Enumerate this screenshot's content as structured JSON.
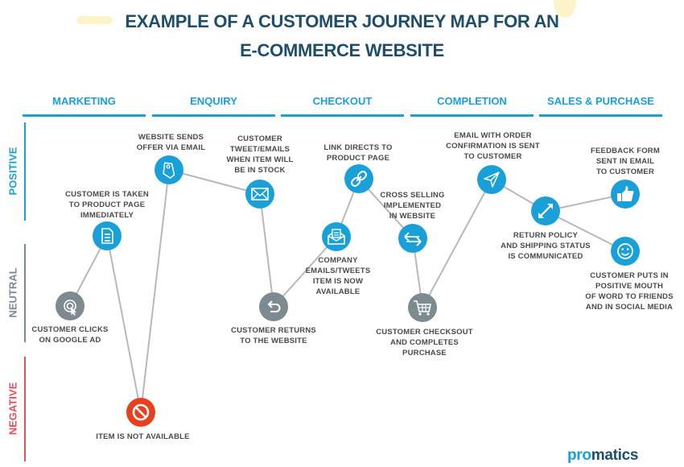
{
  "title": {
    "line1": "EXAMPLE OF A CUSTOMER JOURNEY MAP FOR AN",
    "line2": "E-COMMERCE WEBSITE"
  },
  "stages": [
    "MARKETING",
    "ENQUIRY",
    "CHECKOUT",
    "COMPLETION",
    "SALES & PURCHASE"
  ],
  "emotions": [
    {
      "label": "POSITIVE",
      "color": "#1aa0d8"
    },
    {
      "label": "NEUTRAL",
      "color": "#7d8a90"
    },
    {
      "label": "NEGATIVE",
      "color": "#e8505b"
    }
  ],
  "colors": {
    "title": "#1f4e6b",
    "accent": "#1aa0d8",
    "neutral_node": "#7d8a90",
    "negative_node": "#e8401e",
    "connector": "#b8b8b8"
  },
  "nodes": [
    {
      "id": "google-ad",
      "label": "CUSTOMER CLICKS\nON GOOGLE AD",
      "icon": "click-target-icon",
      "sentiment": "neutral"
    },
    {
      "id": "product-page",
      "label": "CUSTOMER IS TAKEN\nTO PRODUCT PAGE\nIMMEDIATELY",
      "icon": "document-icon",
      "sentiment": "positive"
    },
    {
      "id": "not-available",
      "label": "ITEM IS NOT AVAILABLE",
      "icon": "prohibited-icon",
      "sentiment": "negative"
    },
    {
      "id": "offer-email",
      "label": "WEBSITE SENDS\nOFFER VIA EMAIL",
      "icon": "tag-icon",
      "sentiment": "positive"
    },
    {
      "id": "tweet-email",
      "label": "CUSTOMER\nTWEET/EMAILS\nWHEN ITEM WILL\nBE IN STOCK",
      "icon": "envelope-icon",
      "sentiment": "positive"
    },
    {
      "id": "returns",
      "label": "CUSTOMER RETURNS\nTO THE WEBSITE",
      "icon": "return-arrow-icon",
      "sentiment": "neutral"
    },
    {
      "id": "company-emails",
      "label": "COMPANY\nEMAILS/TWEETS\nITEM IS NOW\nAVAILABLE",
      "icon": "open-mail-icon",
      "sentiment": "positive"
    },
    {
      "id": "link",
      "label": "LINK DIRECTS TO\nPRODUCT PAGE",
      "icon": "link-icon",
      "sentiment": "positive"
    },
    {
      "id": "cross-sell",
      "label": "CROSS SELLING\nIMPLEMENTED\nIN WEBSITE",
      "icon": "exchange-icon",
      "sentiment": "positive"
    },
    {
      "id": "checkout",
      "label": "CUSTOMER CHECKSOUT\nAND COMPLETES\nPURCHASE",
      "icon": "cart-icon",
      "sentiment": "neutral"
    },
    {
      "id": "order-email",
      "label": "EMAIL WITH ORDER\nCONFIRMATION IS SENT\nTO CUSTOMER",
      "icon": "paper-plane-icon",
      "sentiment": "positive"
    },
    {
      "id": "return-policy",
      "label": "RETURN POLICY\nAND SHIPPING STATUS\nIS COMMUNICATED",
      "icon": "expand-arrows-icon",
      "sentiment": "positive"
    },
    {
      "id": "feedback",
      "label": "FEEDBACK FORM\nSENT IN EMAIL\nTO CUSTOMER",
      "icon": "thumbs-up-icon",
      "sentiment": "positive"
    },
    {
      "id": "word-of-mouth",
      "label": "CUSTOMER PUTS IN\nPOSITIVE MOUTH\nOF WORD TO FRIENDS\nAND IN SOCIAL MEDIA",
      "icon": "smiley-icon",
      "sentiment": "positive"
    }
  ],
  "edges": [
    [
      "google-ad",
      "product-page"
    ],
    [
      "product-page",
      "not-available"
    ],
    [
      "not-available",
      "offer-email"
    ],
    [
      "offer-email",
      "tweet-email"
    ],
    [
      "tweet-email",
      "returns"
    ],
    [
      "returns",
      "company-emails"
    ],
    [
      "company-emails",
      "link"
    ],
    [
      "link",
      "cross-sell"
    ],
    [
      "cross-sell",
      "checkout"
    ],
    [
      "checkout",
      "order-email"
    ],
    [
      "order-email",
      "return-policy"
    ],
    [
      "return-policy",
      "feedback"
    ],
    [
      "return-policy",
      "word-of-mouth"
    ]
  ],
  "logo": {
    "part1": "pro",
    "part2": "matics"
  }
}
